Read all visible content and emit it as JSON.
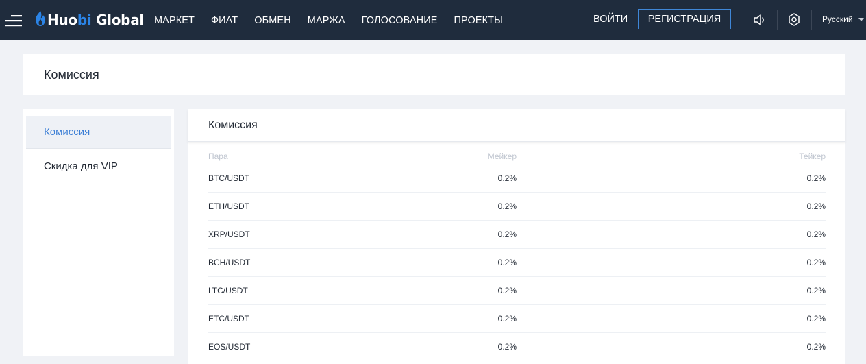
{
  "brand": {
    "name_main": "Huo",
    "name_accent": "bi",
    "name_suffix": " Global"
  },
  "nav": {
    "items": [
      "МАРКЕТ",
      "ФИАТ",
      "ОБМЕН",
      "МАРЖА",
      "ГОЛОСОВАНИЕ",
      "ПРОЕКТЫ"
    ],
    "login_label": "ВОЙТИ",
    "register_label": "РЕГИСТРАЦИЯ",
    "language": "Русский"
  },
  "page": {
    "title": "Комиссия"
  },
  "sidebar": {
    "items": [
      {
        "label": "Комиссия",
        "active": true
      },
      {
        "label": "Скидка для VIP",
        "active": false
      }
    ]
  },
  "fees": {
    "title": "Комиссия",
    "columns": {
      "pair": "Пара",
      "maker": "Мейкер",
      "taker": "Тейкер"
    },
    "rows": [
      {
        "pair": "BTC/USDT",
        "maker": "0.2%",
        "taker": "0.2%"
      },
      {
        "pair": "ETH/USDT",
        "maker": "0.2%",
        "taker": "0.2%"
      },
      {
        "pair": "XRP/USDT",
        "maker": "0.2%",
        "taker": "0.2%"
      },
      {
        "pair": "BCH/USDT",
        "maker": "0.2%",
        "taker": "0.2%"
      },
      {
        "pair": "LTC/USDT",
        "maker": "0.2%",
        "taker": "0.2%"
      },
      {
        "pair": "ETC/USDT",
        "maker": "0.2%",
        "taker": "0.2%"
      },
      {
        "pair": "EOS/USDT",
        "maker": "0.2%",
        "taker": "0.2%"
      }
    ]
  },
  "colors": {
    "topbar": "#1f2c3d",
    "accent": "#3b7ed5",
    "background": "#f0f2f6"
  },
  "icons": [
    "menu-icon",
    "flame-logo-icon",
    "speaker-icon",
    "gear-icon",
    "chevron-down-icon"
  ]
}
